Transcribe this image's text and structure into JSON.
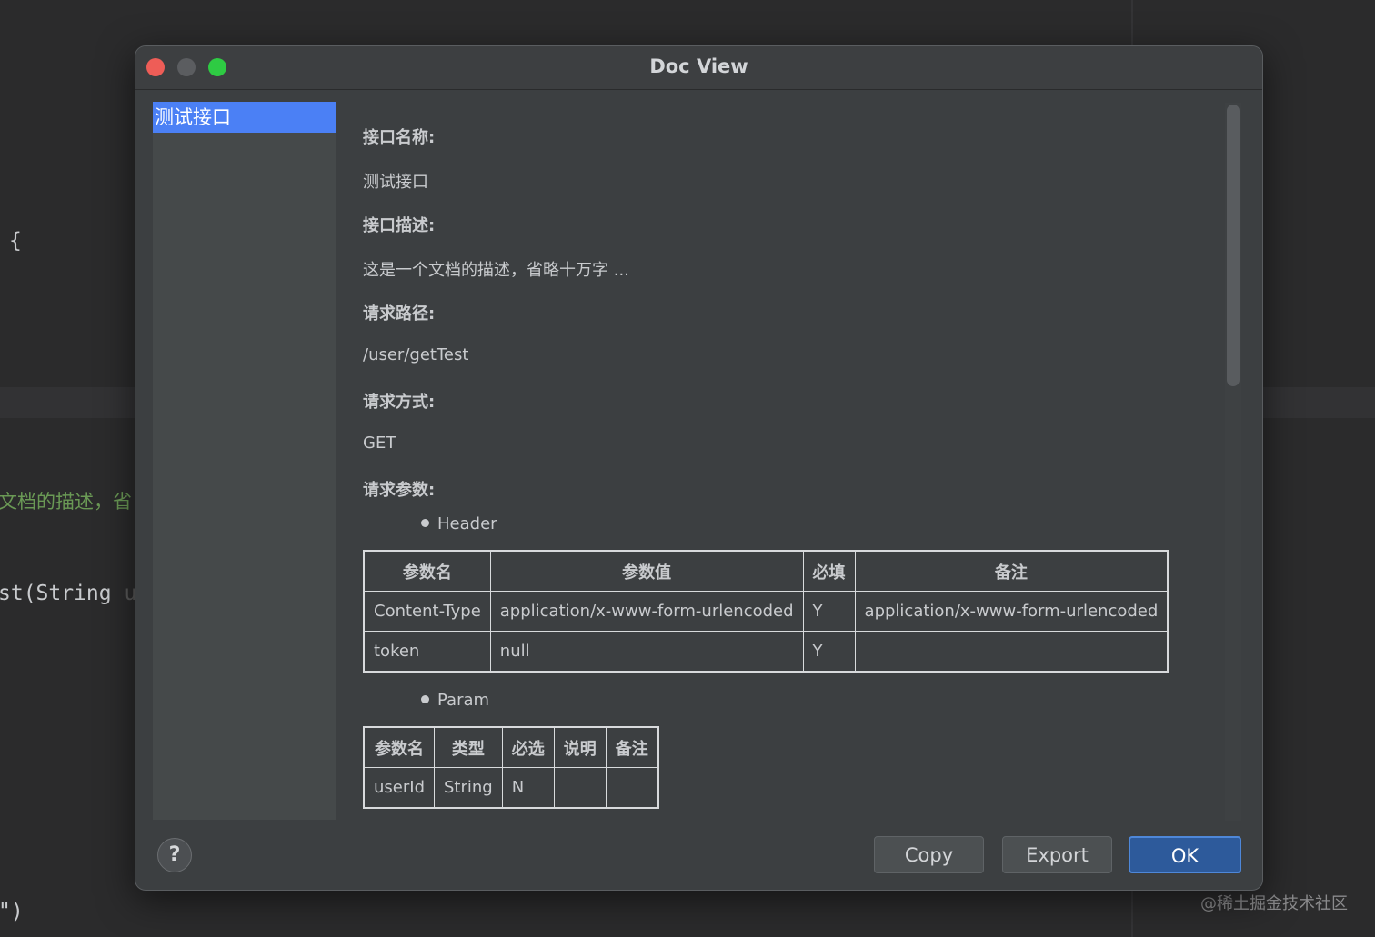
{
  "editor": {
    "brace": "{",
    "comment": "文档的描述，省",
    "sig_method": "st(String",
    "sig_var": "u",
    "end": "\")"
  },
  "watermark": "@稀土掘金技术社区",
  "dialog": {
    "title": "Doc View",
    "sidebar": {
      "items": [
        {
          "label": "测试接口"
        }
      ]
    },
    "content": {
      "name_label": "接口名称:",
      "name_value": "测试接口",
      "desc_label": "接口描述:",
      "desc_value": "这是一个文档的描述，省略十万字 ...",
      "path_label": "请求路径:",
      "path_value": "/user/getTest",
      "method_label": "请求方式:",
      "method_value": "GET",
      "params_label": "请求参数:",
      "header_bullet": "Header",
      "header_table": {
        "headers": [
          "参数名",
          "参数值",
          "必填",
          "备注"
        ],
        "rows": [
          [
            "Content-Type",
            "application/x-www-form-urlencoded",
            "Y",
            "application/x-www-form-urlencoded"
          ],
          [
            "token",
            "null",
            "Y",
            ""
          ]
        ]
      },
      "param_bullet": "Param",
      "param_table": {
        "headers": [
          "参数名",
          "类型",
          "必选",
          "说明",
          "备注"
        ],
        "rows": [
          [
            "userId",
            "String",
            "N",
            "",
            ""
          ]
        ]
      }
    },
    "buttons": {
      "help": "?",
      "copy": "Copy",
      "export": "Export",
      "ok": "OK"
    }
  }
}
